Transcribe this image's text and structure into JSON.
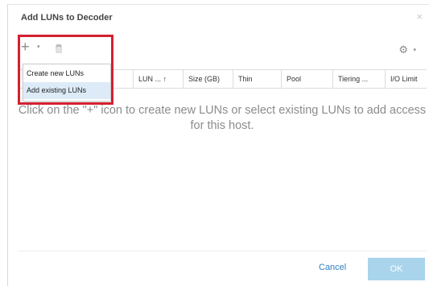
{
  "dialog": {
    "title": "Add LUNs to Decoder",
    "close_symbol": "×"
  },
  "toolbar": {
    "add_icon": "plus-icon",
    "add_symbol": "+",
    "add_caret": "▾",
    "delete_icon": "trash-icon",
    "settings_icon": "gear-icon",
    "settings_symbol": "⚙",
    "settings_caret": "▾"
  },
  "add_menu": {
    "items": [
      {
        "label": "Create new LUNs",
        "selected": false
      },
      {
        "label": "Add existing LUNs",
        "selected": true
      }
    ]
  },
  "table": {
    "columns": [
      {
        "label": "LUN ... ↑"
      },
      {
        "label": "Size (GB)"
      },
      {
        "label": "Thin"
      },
      {
        "label": "Pool"
      },
      {
        "label": "Tiering ..."
      },
      {
        "label": "I/O Limit"
      }
    ],
    "empty_message": "Click on the \"+\" icon to create new LUNs or select existing LUNs to add access for this host."
  },
  "footer": {
    "cancel_label": "Cancel",
    "ok_label": "OK"
  },
  "colors": {
    "highlight": "#d42031",
    "ok_button": "#a9d4ec",
    "link": "#2f7fc0",
    "menu_selected": "#dcebf7"
  }
}
